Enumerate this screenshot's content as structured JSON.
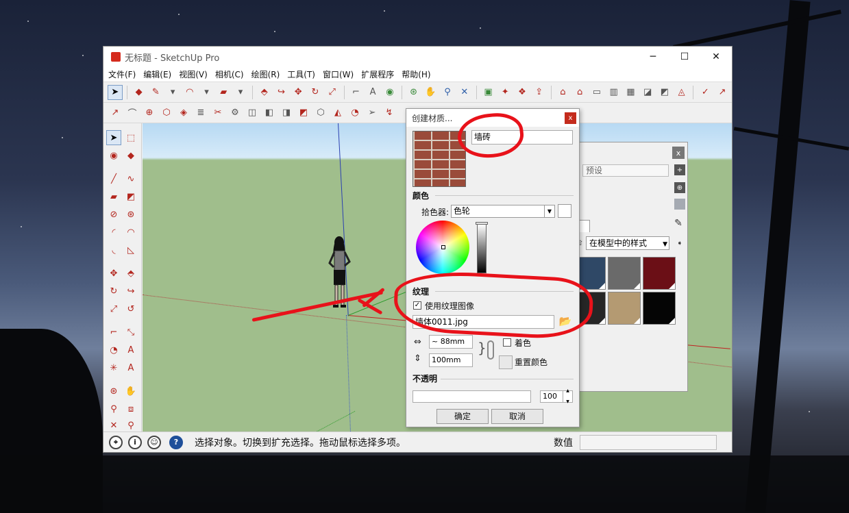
{
  "window": {
    "title": "无标题 - SketchUp Pro",
    "controls": {
      "minimize": "─",
      "maximize": "☐",
      "close": "✕"
    }
  },
  "menu": [
    "文件(F)",
    "编辑(E)",
    "视图(V)",
    "相机(C)",
    "绘图(R)",
    "工具(T)",
    "窗口(W)",
    "扩展程序",
    "帮助(H)"
  ],
  "statusbar": {
    "message": "选择对象。切换到扩充选择。拖动鼠标选择多项。",
    "value_label": "数值",
    "help_icon": "?",
    "info_icon": "i"
  },
  "tray": {
    "preset_placeholder": "预设",
    "model_select": "在模型中的样式",
    "swatches": [
      "#2f4866",
      "#6a6a6a",
      "#6b0f16",
      "#262626",
      "#b49a72",
      "#050505"
    ]
  },
  "dialog": {
    "title": "创建材质...",
    "close": "x",
    "material_name": "墙砖",
    "color_section": "颜色",
    "picker_label": "拾色器:",
    "picker_value": "色轮",
    "texture_section": "纹理",
    "use_texture_label": "使用纹理图像",
    "use_texture_checked": true,
    "texture_file": "墙体0011.jpg",
    "width": "~ 88mm",
    "height": "100mm",
    "colorize_label": "着色",
    "reset_color_label": "重置颜色",
    "opacity_section": "不透明",
    "opacity_value": "100",
    "ok": "确定",
    "cancel": "取消"
  },
  "colors": {
    "annotation": "#e8121a",
    "brick": "#9a4b3a",
    "sky": "#b7d9f3",
    "ground": "#a0be8c"
  }
}
